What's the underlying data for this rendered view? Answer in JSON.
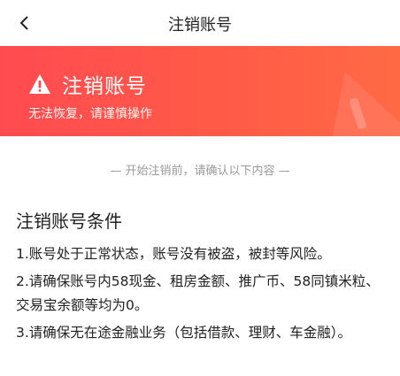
{
  "nav": {
    "title": "注销账号"
  },
  "banner": {
    "title": "注销账号",
    "subtitle": "无法恢复，请谨慎操作",
    "accent_color": "#ff4b50",
    "icon": "warning-triangle-icon"
  },
  "notice": "— 开始注销前，请确认以下内容 —",
  "section": {
    "title": "注销账号条件",
    "conditions": [
      "1.账号处于正常状态，账号没有被盗，被封等风险。",
      "2.请确保账号内58现金、租房金额、推广币、58同镇米粒、交易宝余额等均为0。",
      "3.请确保无在途金融业务（包括借款、理财、车金融）。"
    ]
  }
}
